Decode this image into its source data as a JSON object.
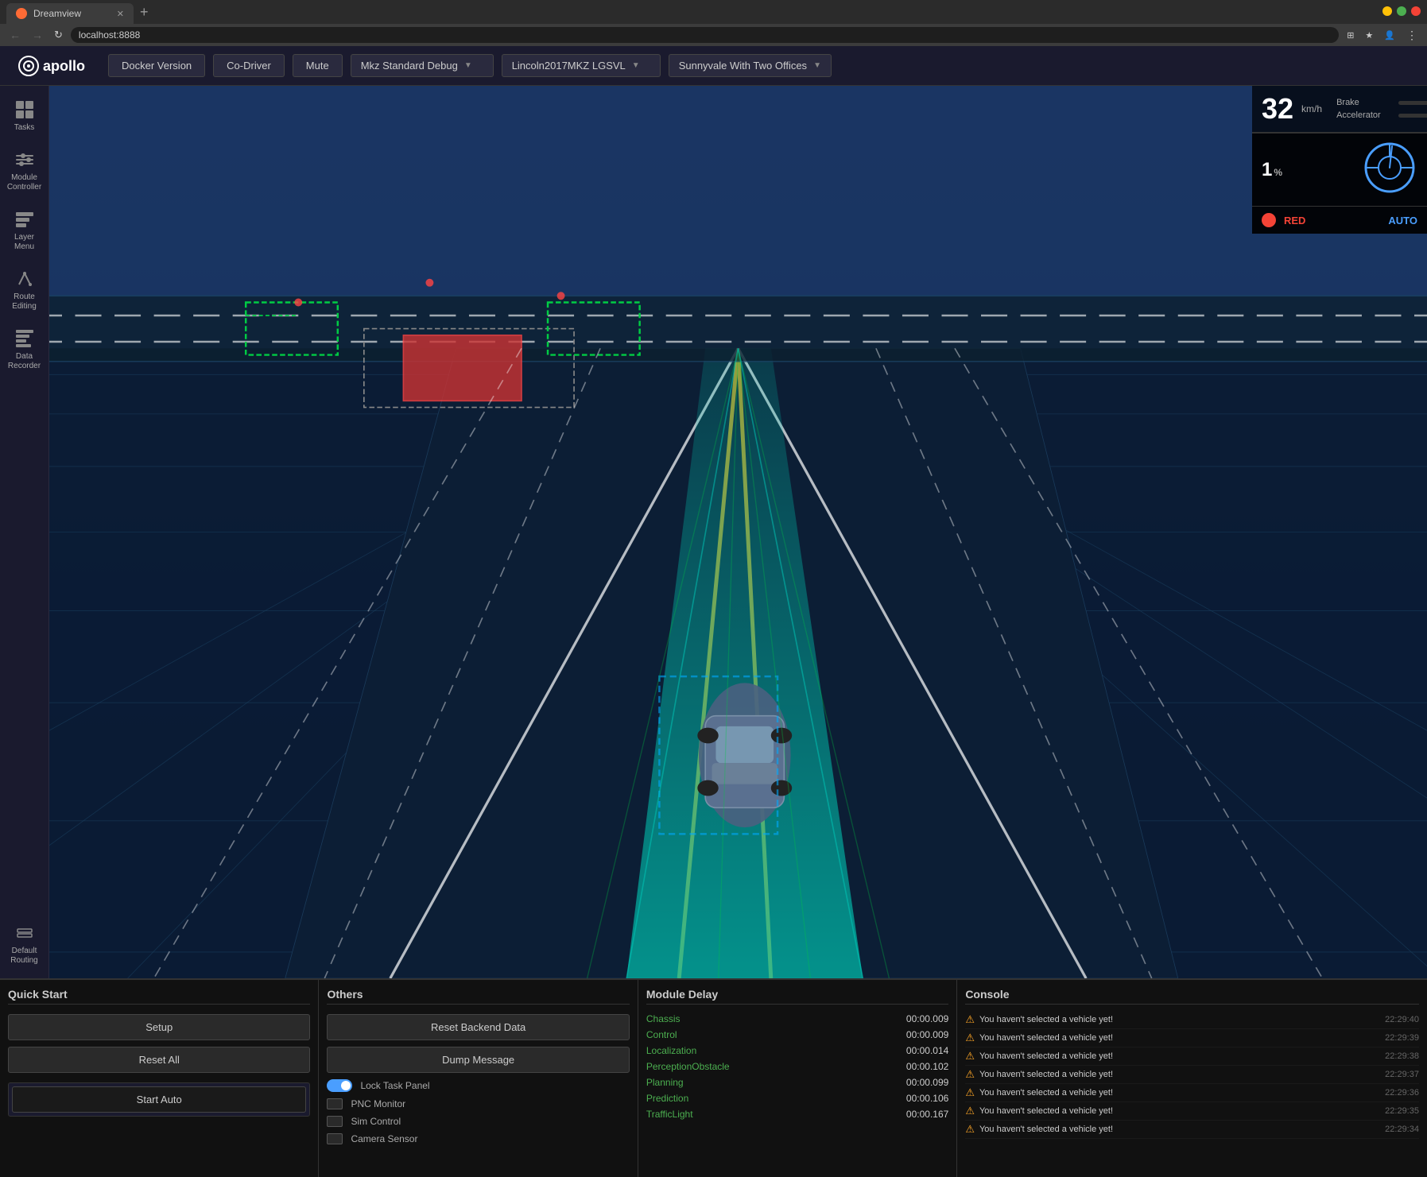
{
  "browser": {
    "tab_title": "Dreamview",
    "url": "localhost:8888",
    "new_tab": "+"
  },
  "topbar": {
    "docker_version": "Docker Version",
    "co_driver": "Co-Driver",
    "mute": "Mute",
    "vehicle_mode": "Mkz Standard Debug",
    "vehicle_model": "Lincoln2017MKZ LGSVL",
    "map": "Sunnyvale With Two Offices"
  },
  "sidebar": {
    "items": [
      {
        "id": "tasks",
        "label": "Tasks"
      },
      {
        "id": "module-controller",
        "label": "Module Controller"
      },
      {
        "id": "layer-menu",
        "label": "Layer Menu"
      },
      {
        "id": "route-editing",
        "label": "Route Editing"
      },
      {
        "id": "data-recorder",
        "label": "Data Recorder"
      },
      {
        "id": "default-routing",
        "label": "Default Routing"
      }
    ]
  },
  "hud": {
    "speed": "32",
    "speed_unit": "km/h",
    "brake_label": "Brake",
    "brake_pct": "0%",
    "accelerator_label": "Accelerator",
    "accelerator_pct": "0%",
    "steering_value": "1",
    "steering_pct": "%",
    "signal_color": "RED",
    "auto_label": "AUTO"
  },
  "quick_start": {
    "title": "Quick Start",
    "setup_label": "Setup",
    "reset_all_label": "Reset All",
    "start_auto_label": "Start Auto"
  },
  "others": {
    "title": "Others",
    "reset_backend": "Reset Backend Data",
    "dump_message": "Dump Message",
    "lock_task_panel": "Lock Task Panel",
    "pnc_monitor": "PNC Monitor",
    "sim_control": "Sim Control",
    "camera_sensor": "Camera Sensor",
    "lock_task_panel_checked": true,
    "pnc_monitor_checked": false,
    "sim_control_checked": false,
    "camera_sensor_checked": false
  },
  "module_delay": {
    "title": "Module Delay",
    "modules": [
      {
        "name": "Chassis",
        "time": "00:00.009"
      },
      {
        "name": "Control",
        "time": "00:00.009"
      },
      {
        "name": "Localization",
        "time": "00:00.014"
      },
      {
        "name": "PerceptionObstacle",
        "time": "00:00.102"
      },
      {
        "name": "Planning",
        "time": "00:00.099"
      },
      {
        "name": "Prediction",
        "time": "00:00.106"
      },
      {
        "name": "TrafficLight",
        "time": "00:00.167"
      }
    ]
  },
  "console": {
    "title": "Console",
    "messages": [
      {
        "text": "You haven't selected a vehicle yet!",
        "time": "22:29:40"
      },
      {
        "text": "You haven't selected a vehicle yet!",
        "time": "22:29:39"
      },
      {
        "text": "You haven't selected a vehicle yet!",
        "time": "22:29:38"
      },
      {
        "text": "You haven't selected a vehicle yet!",
        "time": "22:29:37"
      },
      {
        "text": "You haven't selected a vehicle yet!",
        "time": "22:29:36"
      },
      {
        "text": "You haven't selected a vehicle yet!",
        "time": "22:29:35"
      },
      {
        "text": "You haven't selected a vehicle yet!",
        "time": "22:29:34"
      }
    ]
  },
  "colors": {
    "accent_blue": "#4a9eff",
    "signal_red": "#f44336",
    "module_green": "#4caf50",
    "warn_orange": "#ffa726",
    "bg_dark": "#0d1117",
    "sidebar_bg": "#1a1a2e"
  }
}
